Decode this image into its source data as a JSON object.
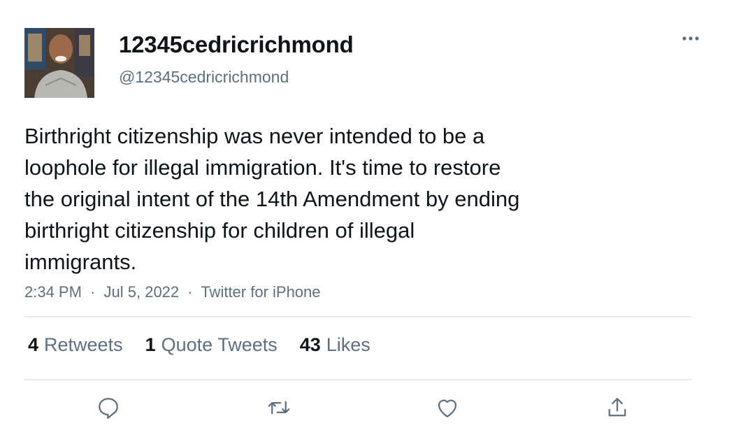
{
  "user": {
    "display_name": "12345cedricrichmond",
    "handle": "@12345cedricrichmond"
  },
  "tweet": {
    "text": "Birthright citizenship was never intended to be a\nloophole for illegal immigration. It's time to restore\nthe original intent of the 14th Amendment by ending\nbirthright citizenship for children of illegal\nimmigrants.",
    "time": "2:34 PM",
    "date": "Jul 5, 2022",
    "separator": "·",
    "source": "Twitter for iPhone"
  },
  "stats": {
    "retweets": {
      "count": "4",
      "label": "Retweets"
    },
    "quotes": {
      "count": "1",
      "label": "Quote Tweets"
    },
    "likes": {
      "count": "43",
      "label": "Likes"
    }
  },
  "icons": {
    "more": "more-dots-icon",
    "reply": "reply-icon",
    "retweet": "retweet-icon",
    "like": "heart-icon",
    "share": "share-icon"
  },
  "colors": {
    "text_primary": "#0f1419",
    "text_secondary": "#5b7083",
    "icon": "#5b7083",
    "divider": "#e6e9eb"
  }
}
